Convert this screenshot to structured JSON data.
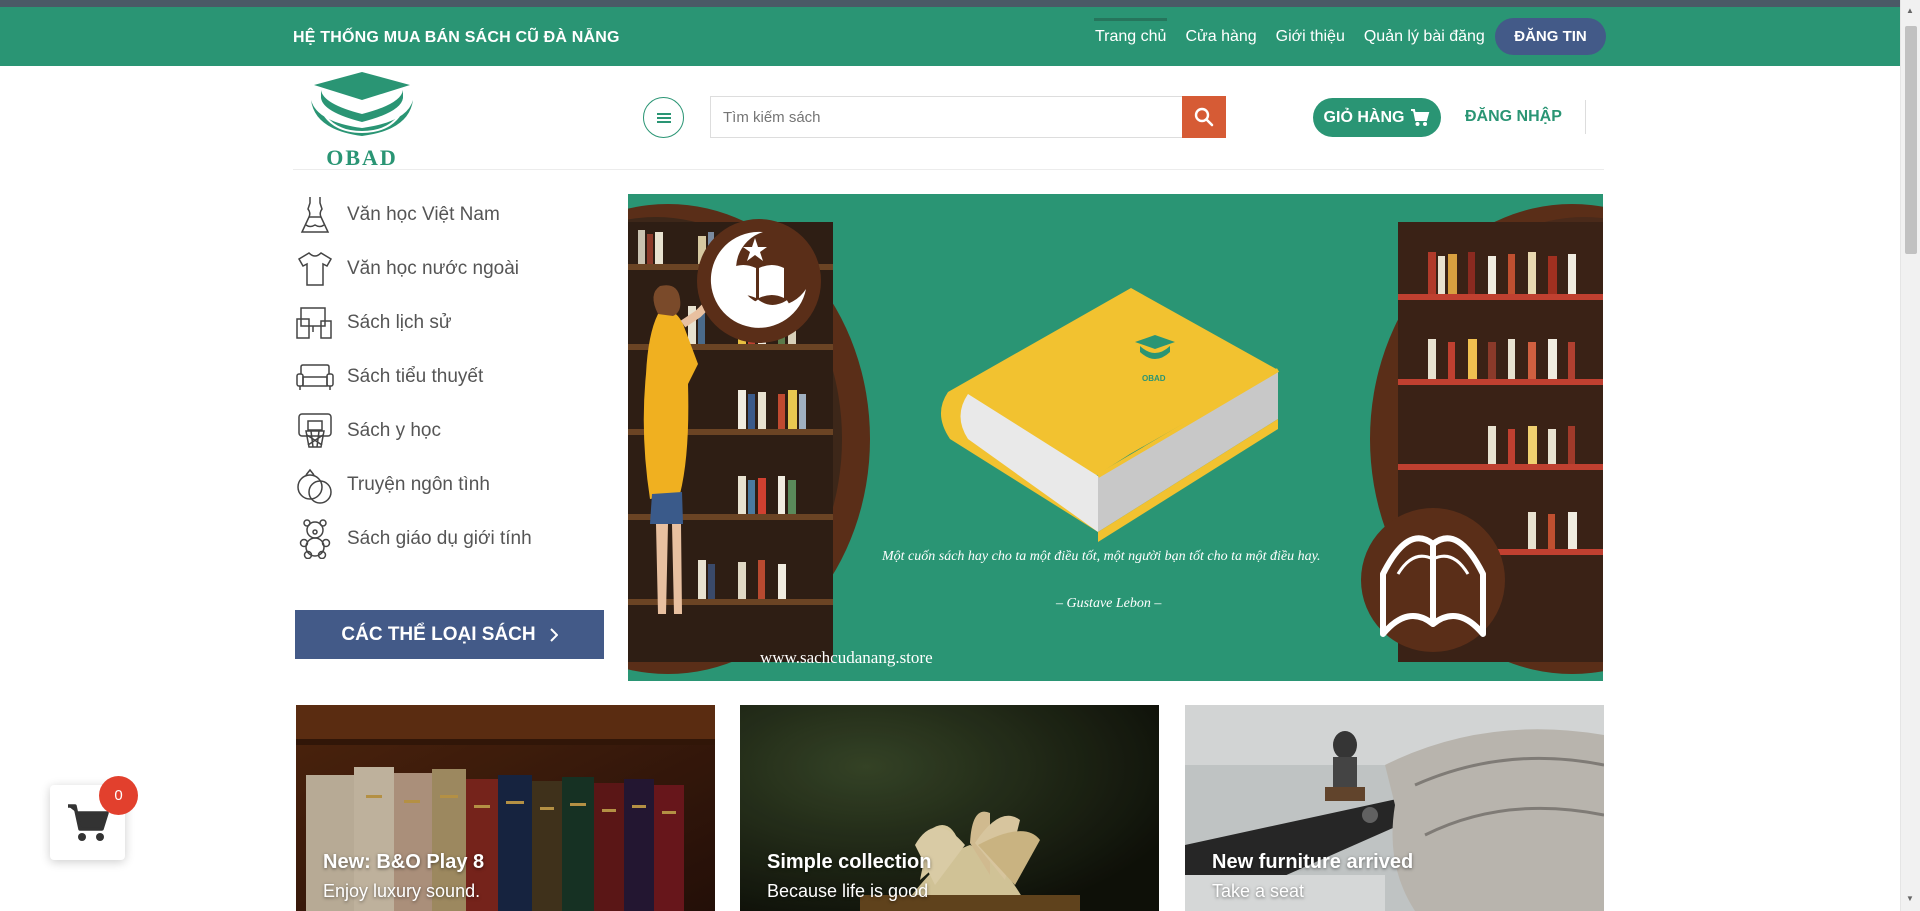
{
  "topbar": {
    "site_title": "HỆ THỐNG MUA BÁN SÁCH CŨ ĐÀ NẴNG",
    "nav": [
      "Trang chủ",
      "Cửa hàng",
      "Giới thiệu",
      "Quản lý bài đăng"
    ],
    "post_button": "ĐĂNG TIN",
    "color": "#2a9574"
  },
  "header": {
    "logo_text": "OBAD",
    "search_placeholder": "Tìm kiếm sách",
    "cart_label": "GIỎ HÀNG",
    "login_label": "ĐĂNG NHẬP"
  },
  "categories": [
    {
      "label": "Văn học Việt Nam",
      "icon": "dress-icon"
    },
    {
      "label": "Văn học nước ngoài",
      "icon": "tshirt-icon"
    },
    {
      "label": "Sách lịch sử",
      "icon": "devices-icon"
    },
    {
      "label": "Sách tiểu thuyết",
      "icon": "sofa-icon"
    },
    {
      "label": "Sách y học",
      "icon": "basketball-hoop-icon"
    },
    {
      "label": "Truyện ngôn tình",
      "icon": "rings-icon"
    },
    {
      "label": "Sách giáo dụ giới tính",
      "icon": "teddy-bear-icon"
    }
  ],
  "categories_button": "CÁC THỂ LOẠI SÁCH",
  "banner": {
    "book_logo_text": "OBAD",
    "quote": "Một cuốn sách hay cho ta một điều tốt, một người bạn tốt cho ta một điều hay.",
    "author": "– Gustave Lebon –",
    "url": "www.sachcudanang.store"
  },
  "cards": [
    {
      "title": "New: B&O Play 8",
      "subtitle": "Enjoy luxury sound."
    },
    {
      "title": "Simple collection",
      "subtitle": "Because life is good"
    },
    {
      "title": "New furniture arrived",
      "subtitle": "Take a seat"
    }
  ],
  "floating_cart": {
    "count": "0"
  },
  "colors": {
    "primary": "#2a9574",
    "secondary": "#435a88",
    "accent": "#d65b35",
    "banner_brown": "#5a2e18",
    "book_yellow": "#f2c230"
  }
}
